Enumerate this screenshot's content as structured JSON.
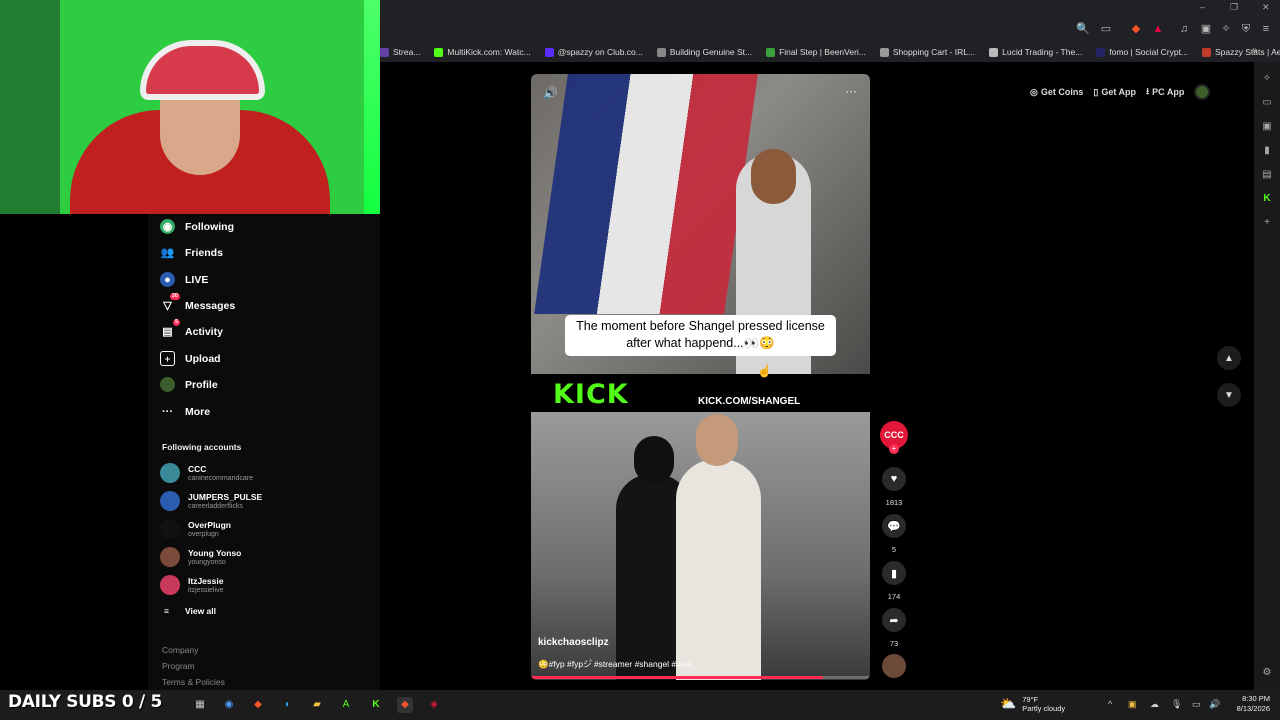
{
  "bookmarks": [
    {
      "label": "Strea...",
      "color": "#6441a5"
    },
    {
      "label": "MultiKick.com: Watc...",
      "color": "#53fc18"
    },
    {
      "label": "@spazzy on Club.co...",
      "color": "#5a2dff"
    },
    {
      "label": "Building Genuine St...",
      "color": "#888888"
    },
    {
      "label": "Final Step | BeenVeri...",
      "color": "#3ca03c"
    },
    {
      "label": "Shopping Cart - IRL...",
      "color": "#999999"
    },
    {
      "label": "Lucid Trading - The...",
      "color": "#bbbbbb"
    },
    {
      "label": "fomo | Social Crypt...",
      "color": "#222266"
    },
    {
      "label": "Spazzy Stats | AeroK...",
      "color": "#c0392b"
    }
  ],
  "sidebar": {
    "nav": [
      {
        "label": "Following",
        "icon": "following-icon"
      },
      {
        "label": "Friends",
        "icon": "friends-icon"
      },
      {
        "label": "LIVE",
        "icon": "live-icon"
      },
      {
        "label": "Messages",
        "icon": "messages-icon",
        "badge": "20"
      },
      {
        "label": "Activity",
        "icon": "activity-icon",
        "badge": "5"
      },
      {
        "label": "Upload",
        "icon": "upload-icon"
      },
      {
        "label": "Profile",
        "icon": "profile-icon"
      },
      {
        "label": "More",
        "icon": "more-icon"
      }
    ],
    "following_title": "Following accounts",
    "accounts": [
      {
        "name": "CCC",
        "handle": "caninecommandcare",
        "color": "#3a8a9a"
      },
      {
        "name": "JUMPERS_PULSE",
        "handle": "careerladderflicks",
        "color": "#2a5db0"
      },
      {
        "name": "OverPlugn",
        "handle": "overplugn",
        "color": "#111111"
      },
      {
        "name": "Young Yonso",
        "handle": "youngyonso",
        "color": "#7a4a3a"
      },
      {
        "name": "ItzJessie",
        "handle": "itzjessielive",
        "color": "#c83a5a"
      }
    ],
    "view_all": "View all",
    "footer": [
      "Company",
      "Program",
      "Terms & Policies"
    ]
  },
  "video": {
    "caption": "The moment before  Shangel pressed license after what happend...👀😳",
    "kick_logo": "KICK",
    "kick_url": "KICK.COM/SHANGEL",
    "username": "kickchaosclipz",
    "description": "😳#fyp #fypシ゚ #streamer #shangel #viral",
    "progress_pct": 86
  },
  "actions": {
    "creator_label": "CCC",
    "likes": "1813",
    "comments": "5",
    "saves": "174",
    "shares": "73"
  },
  "top_actions": {
    "get_coins": "Get Coins",
    "get_app": "Get App",
    "pc_app": "PC App"
  },
  "taskbar": {
    "overlay_text": "DAILY SUBS 0 / 5",
    "weather_temp": "79°F",
    "weather_desc": "Partly cloudy",
    "time": "8:30 PM",
    "date": "8/13/2026"
  }
}
